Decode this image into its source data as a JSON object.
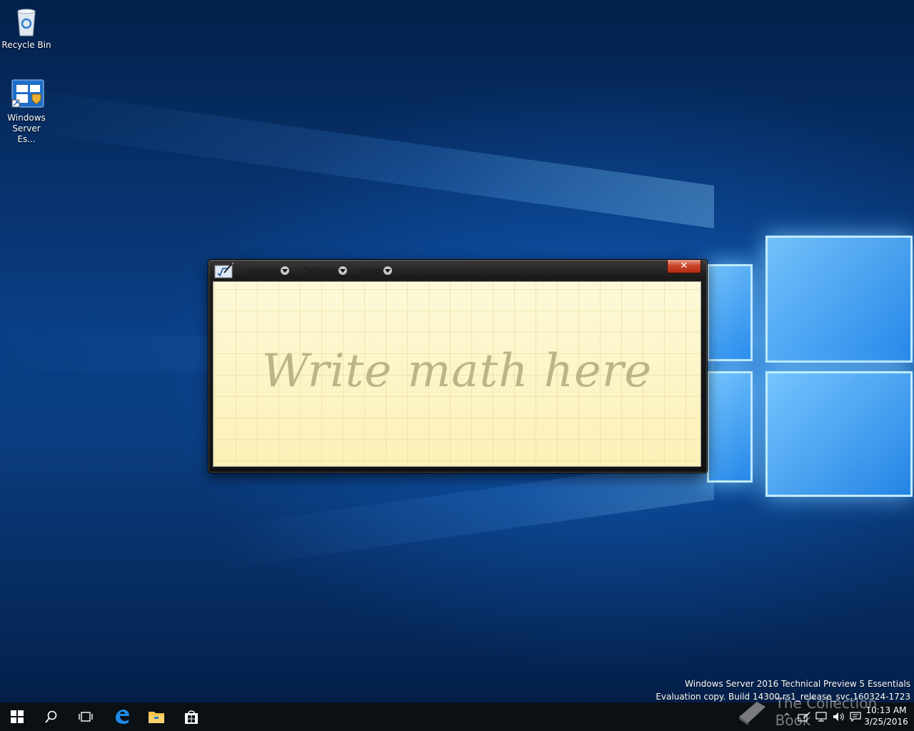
{
  "desktop": {
    "icons": [
      {
        "label": "Recycle Bin"
      },
      {
        "label": "Windows Server Es..."
      }
    ]
  },
  "window": {
    "menu": [
      {
        "label": "History"
      },
      {
        "label": "Options"
      },
      {
        "label": "Help"
      }
    ],
    "close_label": "✕",
    "pad_hint": "Write math here"
  },
  "watermark": {
    "line1": "Windows Server 2016 Technical Preview 5 Essentials",
    "line2": "Evaluation copy. Build 14300.rs1_release_svc.160324-1723"
  },
  "overlay": {
    "text": "The Collection Book"
  },
  "taskbar": {
    "time": "10:13 AM",
    "date": "3/25/2016"
  }
}
